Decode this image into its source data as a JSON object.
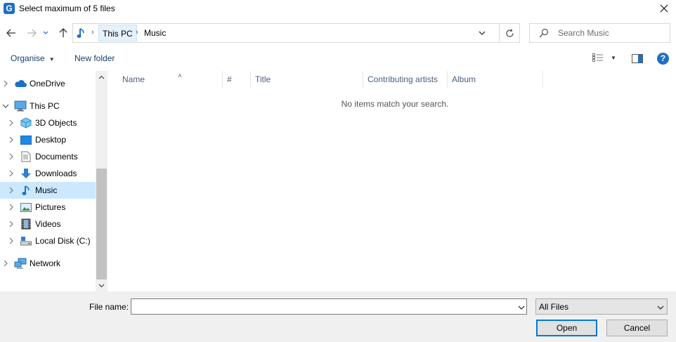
{
  "window": {
    "title": "Select maximum of 5 files"
  },
  "address": {
    "crumbs": [
      "This PC",
      "Music"
    ]
  },
  "search": {
    "placeholder": "Search Music"
  },
  "toolbar": {
    "organise": "Organise",
    "new_folder": "New folder"
  },
  "nav": {
    "items": [
      {
        "label": "OneDrive",
        "icon": "onedrive-icon"
      },
      {
        "label": "This PC",
        "icon": "computer-icon"
      },
      {
        "label": "3D Objects",
        "icon": "3d-objects-icon"
      },
      {
        "label": "Desktop",
        "icon": "desktop-icon"
      },
      {
        "label": "Documents",
        "icon": "documents-icon"
      },
      {
        "label": "Downloads",
        "icon": "downloads-icon"
      },
      {
        "label": "Music",
        "icon": "music-icon",
        "selected": true
      },
      {
        "label": "Pictures",
        "icon": "pictures-icon"
      },
      {
        "label": "Videos",
        "icon": "videos-icon"
      },
      {
        "label": "Local Disk (C:)",
        "icon": "drive-icon"
      },
      {
        "label": "Network",
        "icon": "network-icon"
      }
    ]
  },
  "columns": [
    "Name",
    "#",
    "Title",
    "Contributing artists",
    "Album"
  ],
  "empty_message": "No items match your search.",
  "footer": {
    "file_name_label": "File name:",
    "file_name_value": "",
    "file_type": "All Files",
    "open": "Open",
    "cancel": "Cancel"
  },
  "colors": {
    "accent": "#0078d7",
    "selected": "#cce8ff",
    "footer_bg": "#f0f0f0"
  }
}
